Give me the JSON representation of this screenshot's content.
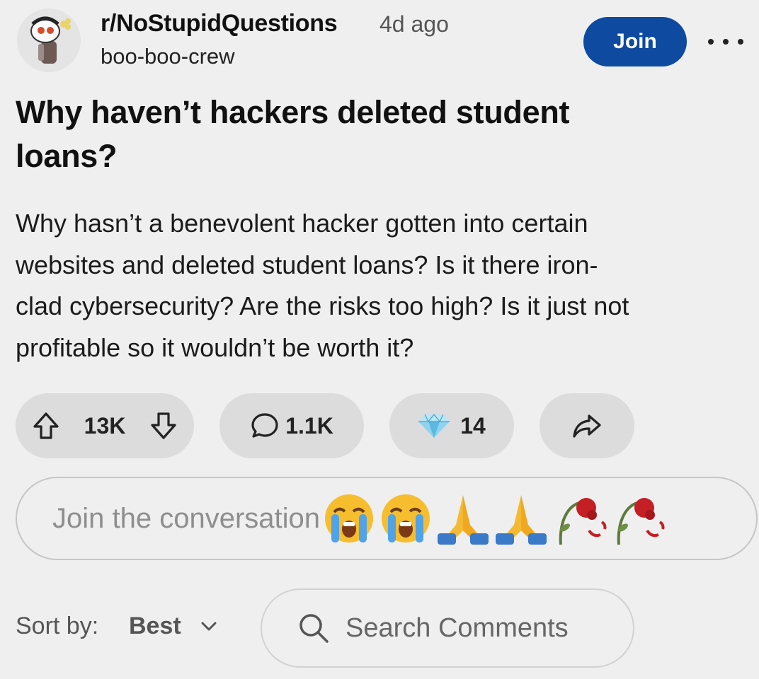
{
  "header": {
    "subreddit": "r/NoStupidQuestions",
    "time_ago": "4d ago",
    "username": "boo-boo-crew",
    "join_label": "Join",
    "avatar_icon": "snoo-avatar-icon",
    "more_icon": "more-options-icon"
  },
  "post": {
    "title_line1": "Why haven’t hackers deleted student",
    "title_line2": "loans?",
    "body_lines": [
      "Why hasn’t a benevolent hacker gotten into certain",
      "websites and deleted student loans? Is it there iron-",
      "clad cybersecurity? Are the risks too high? Is it just not",
      "profitable so it wouldn’t be worth it?"
    ]
  },
  "actions": {
    "score": "13K",
    "comments": "1.1K",
    "awards": "14",
    "icons": [
      "upvote-icon",
      "downvote-icon",
      "comment-icon",
      "diamond-award-icon",
      "share-icon"
    ]
  },
  "conversation": {
    "placeholder": "Join the conversation",
    "emojis": [
      "loudly-crying-face",
      "loudly-crying-face",
      "folded-hands",
      "folded-hands",
      "wilted-flower",
      "wilted-flower"
    ]
  },
  "sort": {
    "label": "Sort by:",
    "value": "Best"
  },
  "search": {
    "placeholder": "Search Comments"
  },
  "colors": {
    "background": "#efefef",
    "join_button": "#0d4aa0",
    "pill": "#dcdcdc"
  }
}
